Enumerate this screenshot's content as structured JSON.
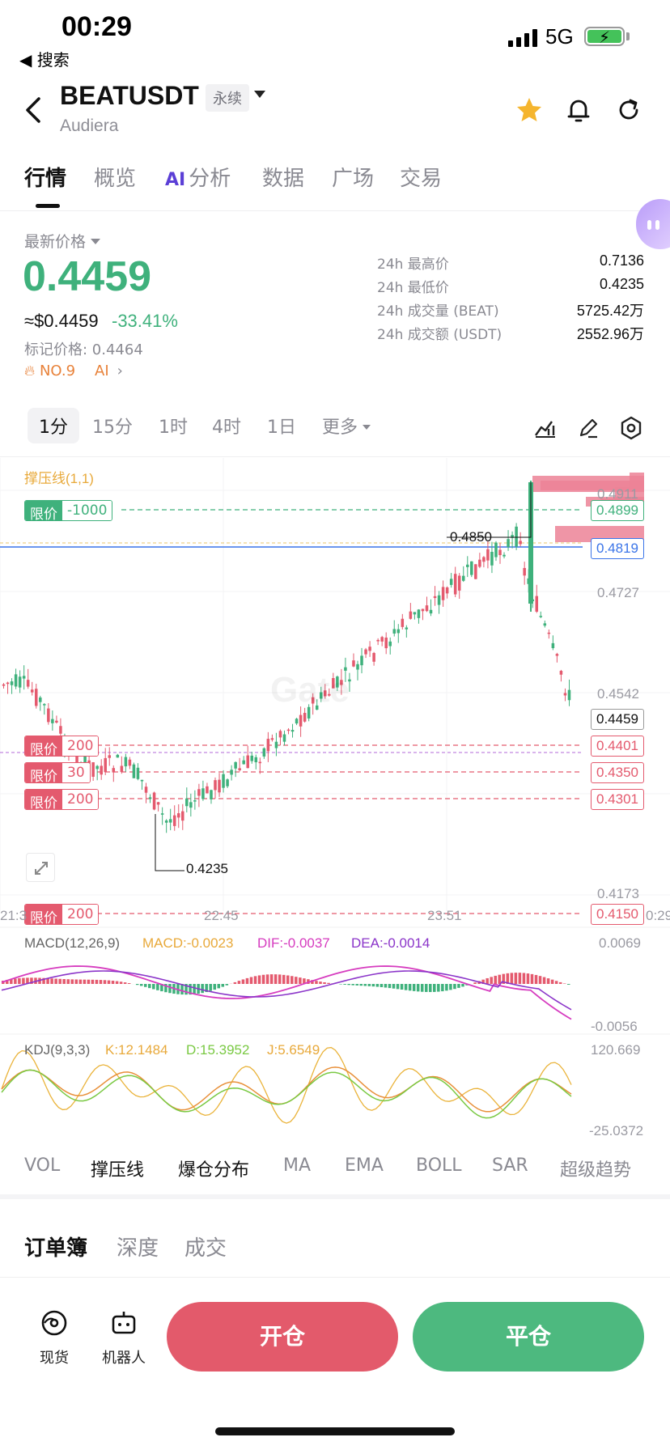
{
  "status": {
    "time": "00:29",
    "back_app": "◀ 搜索",
    "network": "5G"
  },
  "header": {
    "symbol": "BEATUSDT",
    "contract_type": "永续",
    "name": "Audiera"
  },
  "tabs": [
    "行情",
    "概览",
    "分析",
    "数据",
    "广场",
    "交易"
  ],
  "tab_ai_prefix": "AI",
  "price": {
    "label": "最新价格",
    "last": "0.4459",
    "usd": "≈$0.4459",
    "change_pct": "-33.41%",
    "mark": "标记价格: 0.4464",
    "rank": "NO.9",
    "ai": "AI"
  },
  "stats": [
    {
      "k": "24h 最高价",
      "v": "0.7136"
    },
    {
      "k": "24h 最低价",
      "v": "0.4235"
    },
    {
      "k": "24h 成交量 (BEAT)",
      "v": "5725.42万"
    },
    {
      "k": "24h 成交额 (USDT)",
      "v": "2552.96万"
    }
  ],
  "timeframes": [
    "1分",
    "15分",
    "1时",
    "4时",
    "1日",
    "更多"
  ],
  "chart": {
    "indicator_title": "撑压线(1,1)",
    "watermark": "Gate",
    "high_marker": "0.4850",
    "low_marker": "0.4235",
    "axis_prices": [
      "0.4911",
      "0.4727",
      "0.4542",
      "0.4173"
    ],
    "time_labels": [
      "21:3",
      "22:45",
      "23:51",
      "0:29"
    ],
    "orders": [
      {
        "side": "limit",
        "qty": "-1000",
        "price": "0.4899",
        "color": "green"
      },
      {
        "side": "limit",
        "qty": "200",
        "price": "0.4401",
        "color": "red"
      },
      {
        "side": "limit",
        "qty": "30",
        "price": "0.4350",
        "color": "red"
      },
      {
        "side": "limit",
        "qty": "200",
        "price": "0.4301",
        "color": "red"
      },
      {
        "side": "limit",
        "qty": "200",
        "price": "0.4150",
        "color": "red"
      }
    ],
    "order_label": "限价",
    "blue_line_price": "0.4819",
    "current_price": "0.4459",
    "macd": {
      "title": "MACD(12,26,9)",
      "macd": "MACD:-0.0023",
      "dif": "DIF:-0.0037",
      "dea": "DEA:-0.0014",
      "top": "0.0069",
      "bottom": "-0.0056"
    },
    "kdj": {
      "title": "KDJ(9,3,3)",
      "k": "K:12.1484",
      "d": "D:15.3952",
      "j": "J:5.6549",
      "top": "120.669",
      "bottom": "-25.0372"
    }
  },
  "indicator_tabs": [
    "VOL",
    "撑压线",
    "爆仓分布",
    "MA",
    "EMA",
    "BOLL",
    "SAR",
    "超级趋势"
  ],
  "orderbook_tabs": [
    "订单簿",
    "深度",
    "成交"
  ],
  "footer": {
    "spot": "现货",
    "bot": "机器人",
    "open": "开仓",
    "close": "平仓"
  },
  "colors": {
    "up": "#3fb17c",
    "down": "#e45a6e",
    "blue": "#3a74e8",
    "ai_purple": "#5b3fd6"
  }
}
